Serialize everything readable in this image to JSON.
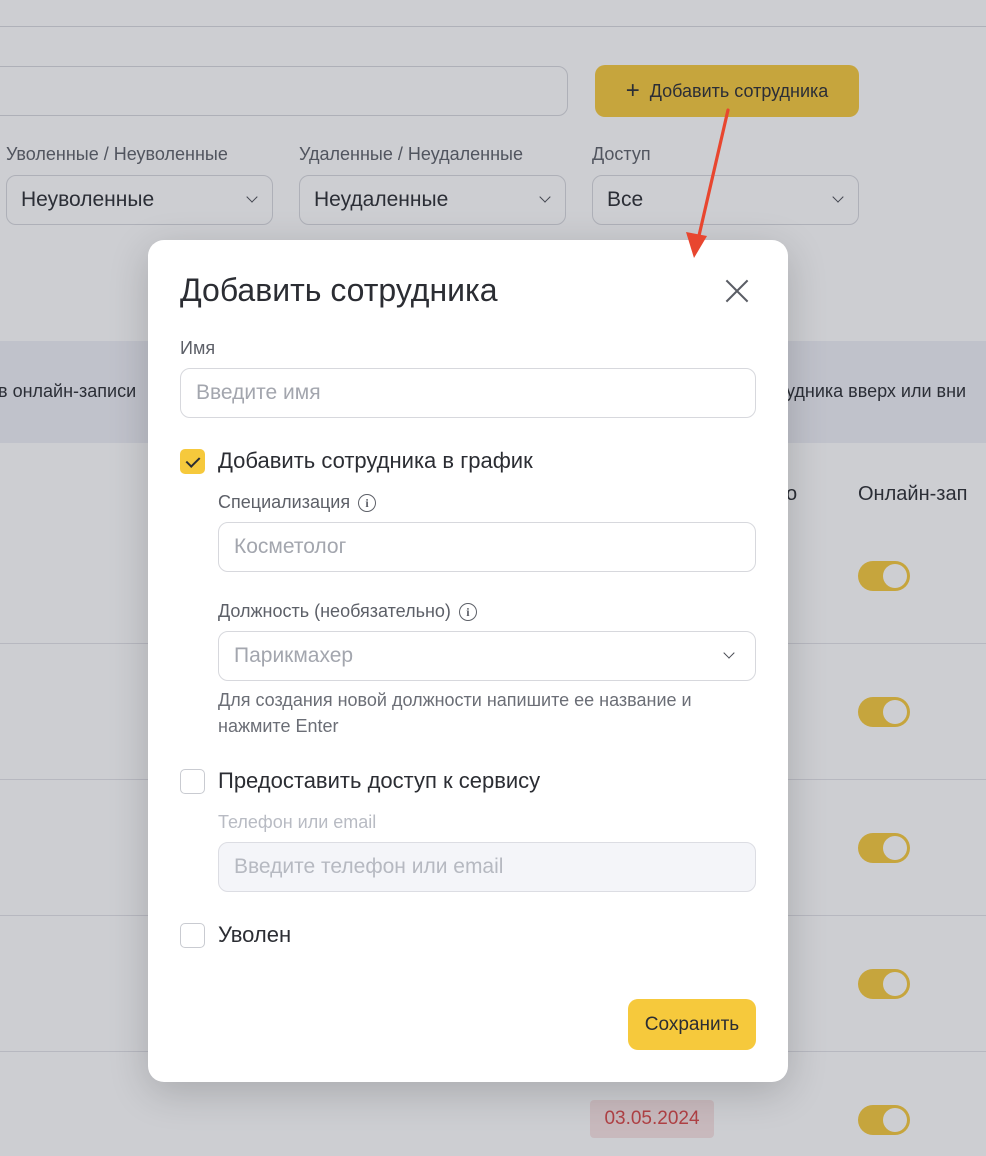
{
  "background": {
    "add_employee_button": "Добавить сотрудника",
    "filters": [
      {
        "label": "Уволенные / Неуволенные",
        "value": "Неуволенные"
      },
      {
        "label": "Удаленные / Неудаленные",
        "value": "Неудаленные"
      },
      {
        "label": "Доступ",
        "value": "Все"
      }
    ],
    "info_strip_left": "в онлайн-записи",
    "info_strip_right": "удника вверх или вни",
    "column_partial": "о",
    "column_online": "Онлайн-зап",
    "date_badge": "03.05.2024",
    "toggles_on": 5
  },
  "modal": {
    "title": "Добавить сотрудника",
    "name_label": "Имя",
    "name_placeholder": "Введите имя",
    "schedule_checkbox": {
      "label": "Добавить сотрудника в график",
      "checked": true
    },
    "specialization_label": "Специализация",
    "specialization_placeholder": "Косметолог",
    "position_label": "Должность (необязательно)",
    "position_placeholder": "Парикмахер",
    "position_hint": "Для создания новой должности напишите ее название и нажмите Enter",
    "access_checkbox": {
      "label": "Предоставить доступ к сервису",
      "checked": false
    },
    "contact_label": "Телефон или email",
    "contact_placeholder": "Введите телефон или email",
    "fired_checkbox": {
      "label": "Уволен",
      "checked": false
    },
    "save_button": "Сохранить"
  },
  "colors": {
    "accent": "#f6c93c",
    "arrow": "#e8462f",
    "badge_bg": "#f9e4e4",
    "badge_text": "#d94646"
  }
}
